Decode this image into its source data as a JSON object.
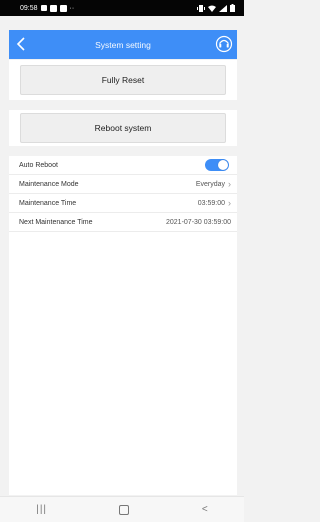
{
  "status_bar": {
    "time": "09:58",
    "more": "··"
  },
  "header": {
    "title": "System setting"
  },
  "buttons": {
    "fully_reset": "Fully Reset",
    "reboot_system": "Reboot system"
  },
  "settings": [
    {
      "label": "Auto Reboot",
      "type": "toggle",
      "value": "on"
    },
    {
      "label": "Maintenance Mode",
      "type": "select",
      "value": "Everyday"
    },
    {
      "label": "Maintenance Time",
      "type": "select",
      "value": "03:59:00"
    },
    {
      "label": "Next Maintenance Time",
      "type": "text",
      "value": "2021-07-30 03:59:00"
    }
  ],
  "nav": {
    "recent": "|||",
    "back": "<"
  },
  "colors": {
    "accent": "#3e8ef7",
    "status_bar": "#050505",
    "background": "#f2f2f2"
  }
}
